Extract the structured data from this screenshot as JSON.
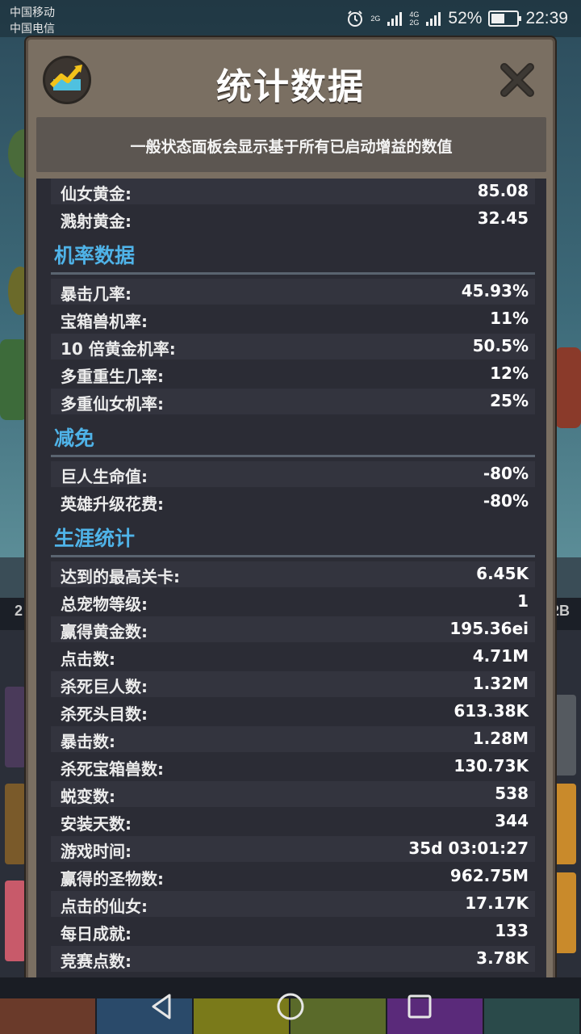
{
  "status_bar": {
    "carrier_1": "中国移动",
    "carrier_2": "中国电信",
    "net_1": "2G",
    "net_2a": "4G",
    "net_2b": "2G",
    "battery_percent": "52%",
    "battery_level": 0.52,
    "time": "22:39"
  },
  "background": {
    "left_number": "2",
    "right_number": "2B"
  },
  "modal": {
    "title": "统计数据",
    "info_text": "一般状态面板会显示基于所有已启动增益的数值",
    "top_rows": [
      {
        "label": "仙女黄金:",
        "value": "85.08"
      },
      {
        "label": "溅射黄金:",
        "value": "32.45"
      }
    ],
    "sections": [
      {
        "title": "机率数据",
        "rows": [
          {
            "label": "暴击几率:",
            "value": "45.93%"
          },
          {
            "label": "宝箱兽机率:",
            "value": "11%"
          },
          {
            "label": "10 倍黄金机率:",
            "value": "50.5%"
          },
          {
            "label": "多重重生几率:",
            "value": "12%"
          },
          {
            "label": "多重仙女机率:",
            "value": "25%"
          }
        ]
      },
      {
        "title": "减免",
        "rows": [
          {
            "label": "巨人生命值:",
            "value": "-80%"
          },
          {
            "label": "英雄升级花费:",
            "value": "-80%"
          }
        ]
      },
      {
        "title": "生涯统计",
        "rows": [
          {
            "label": "达到的最高关卡:",
            "value": "6.45K"
          },
          {
            "label": "总宠物等级:",
            "value": "1"
          },
          {
            "label": "赢得黄金数:",
            "value": "195.36ei"
          },
          {
            "label": "点击数:",
            "value": "4.71M"
          },
          {
            "label": "杀死巨人数:",
            "value": "1.32M"
          },
          {
            "label": "杀死头目数:",
            "value": "613.38K"
          },
          {
            "label": "暴击数:",
            "value": "1.28M"
          },
          {
            "label": "杀死宝箱兽数:",
            "value": "130.73K"
          },
          {
            "label": "蜕变数:",
            "value": "538"
          },
          {
            "label": "安装天数:",
            "value": "344"
          },
          {
            "label": "游戏时间:",
            "value": "35d 03:01:27"
          },
          {
            "label": "赢得的圣物数:",
            "value": "962.75M"
          },
          {
            "label": "点击的仙女:",
            "value": "17.17K"
          },
          {
            "label": "每日成就:",
            "value": "133"
          },
          {
            "label": "竞赛点数:",
            "value": "3.78K"
          }
        ]
      }
    ]
  },
  "colors": {
    "section_title": "#4fb3e8",
    "panel_bg": "#2b2c35",
    "row_alt": "#33343e",
    "modal_frame": "#7a6f62"
  },
  "icons": {
    "header": "stats-chart-icon",
    "close": "close-icon",
    "nav": [
      "back-icon",
      "home-icon",
      "recents-icon"
    ],
    "tabs": [
      "sword-icon",
      "potion-icon",
      "shirt-icon",
      "helmet-icon",
      "pet-icon",
      "star-icon"
    ]
  }
}
